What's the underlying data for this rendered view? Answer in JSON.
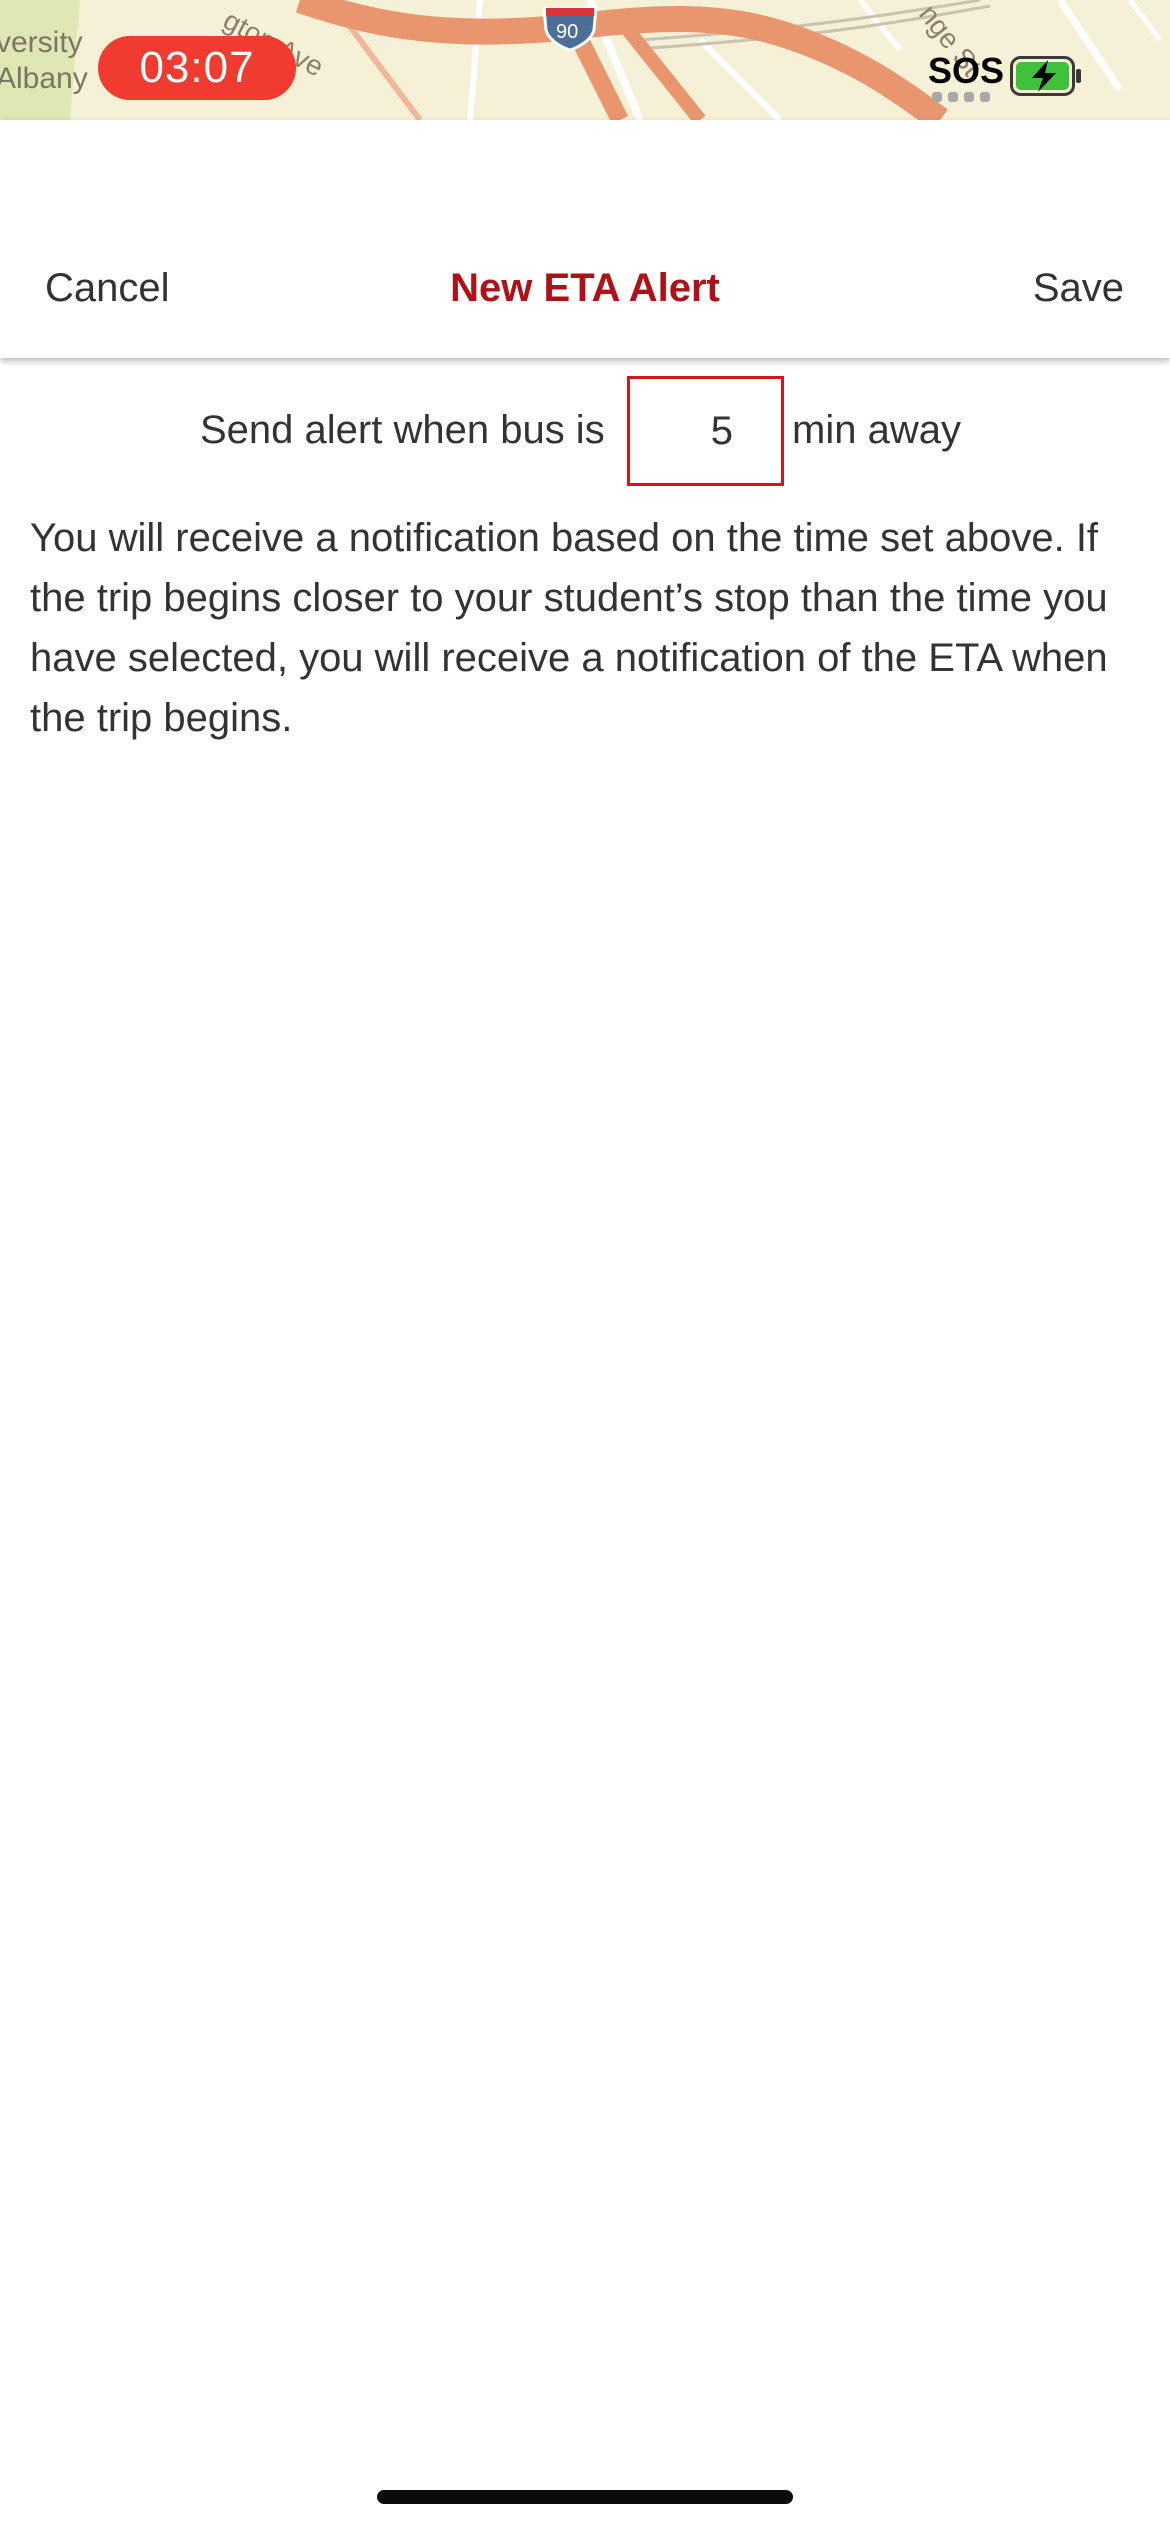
{
  "status_bar": {
    "timer": "03:07",
    "sos": "SOS"
  },
  "map": {
    "place_label_line1": "versity",
    "place_label_line2": "Albany",
    "street_label_a": "gton Ave",
    "street_label_b": "nge St",
    "highway_shield": "90"
  },
  "header": {
    "cancel_label": "Cancel",
    "title": "New ETA Alert",
    "save_label": "Save",
    "title_color": "#b01116"
  },
  "alert": {
    "prefix": "Send alert when bus is",
    "minutes_value": "5",
    "suffix": "min away",
    "field_border_color": "#d2161c"
  },
  "description": "You will receive a notification based on the time set above. If the trip begins closer to your student’s stop than the time you have selected, you will receive a notification of the ETA when the trip begins."
}
